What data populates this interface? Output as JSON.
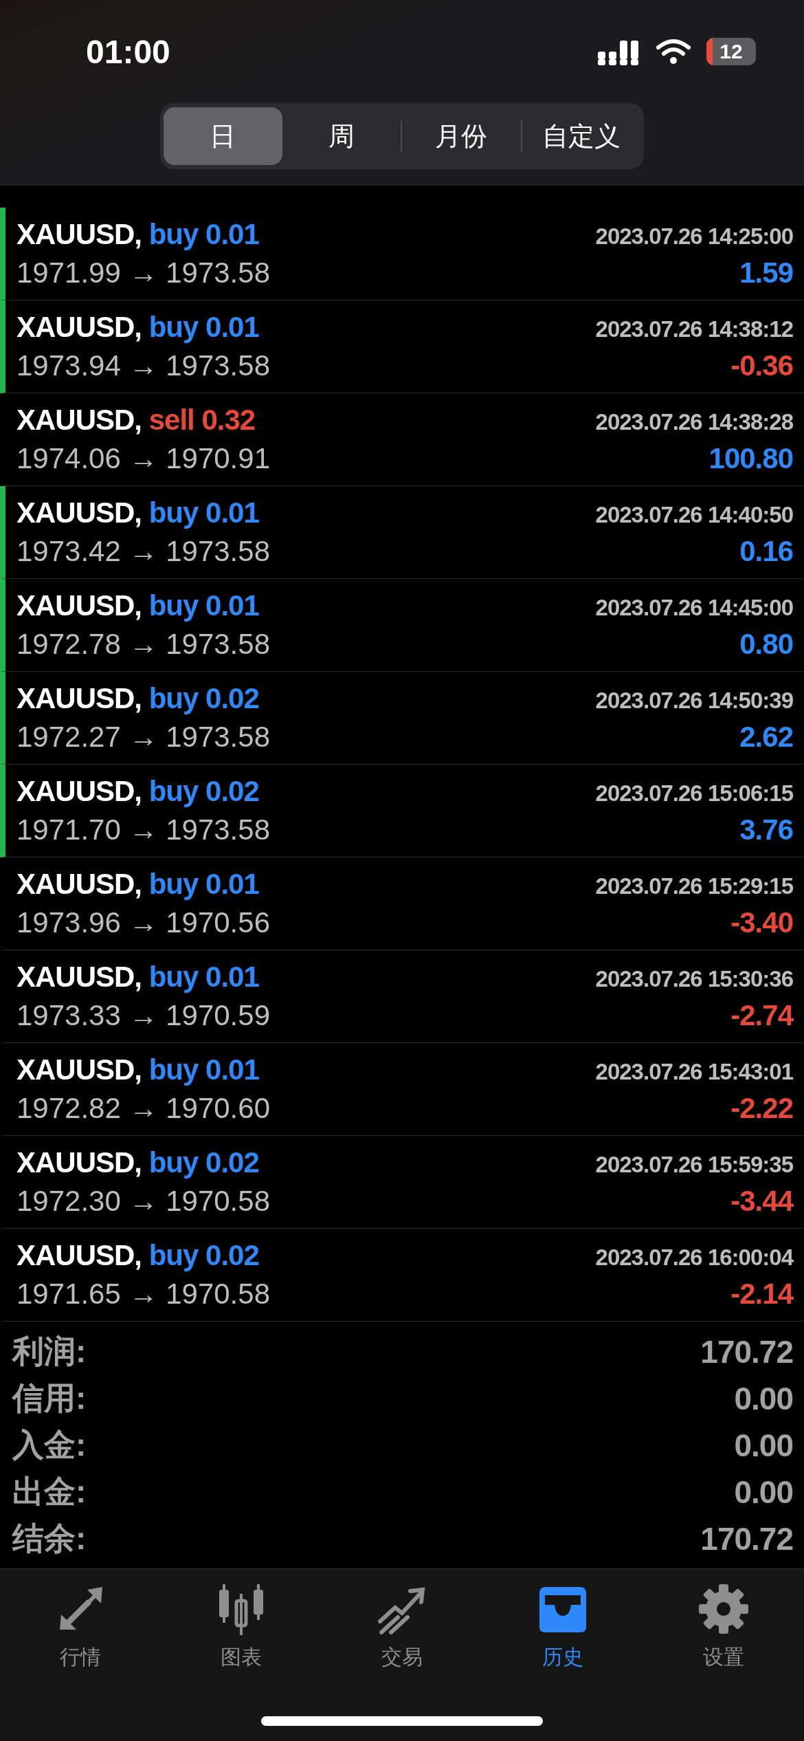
{
  "status_bar": {
    "time": "01:00",
    "battery": "12"
  },
  "period_tabs": [
    {
      "label": "日",
      "selected": true
    },
    {
      "label": "周",
      "selected": false
    },
    {
      "label": "月份",
      "selected": false
    },
    {
      "label": "自定义",
      "selected": false
    }
  ],
  "deals": [
    {
      "symbol": "XAUUSD,",
      "side": "buy",
      "kind": "buy",
      "volume": "0.01",
      "time": "2023.07.26 14:25:00",
      "open": "1971.99",
      "close": "1973.58",
      "arrow": "→",
      "profit": "1.59",
      "loss": false,
      "marked": true
    },
    {
      "symbol": "XAUUSD,",
      "side": "buy",
      "kind": "buy",
      "volume": "0.01",
      "time": "2023.07.26 14:38:12",
      "open": "1973.94",
      "close": "1973.58",
      "arrow": "→",
      "profit": "-0.36",
      "loss": true,
      "marked": true
    },
    {
      "symbol": "XAUUSD,",
      "side": "sell",
      "kind": "sell",
      "volume": "0.32",
      "time": "2023.07.26 14:38:28",
      "open": "1974.06",
      "close": "1970.91",
      "arrow": "→",
      "profit": "100.80",
      "loss": false,
      "marked": false
    },
    {
      "symbol": "XAUUSD,",
      "side": "buy",
      "kind": "buy",
      "volume": "0.01",
      "time": "2023.07.26 14:40:50",
      "open": "1973.42",
      "close": "1973.58",
      "arrow": "→",
      "profit": "0.16",
      "loss": false,
      "marked": true
    },
    {
      "symbol": "XAUUSD,",
      "side": "buy",
      "kind": "buy",
      "volume": "0.01",
      "time": "2023.07.26 14:45:00",
      "open": "1972.78",
      "close": "1973.58",
      "arrow": "→",
      "profit": "0.80",
      "loss": false,
      "marked": true
    },
    {
      "symbol": "XAUUSD,",
      "side": "buy",
      "kind": "buy",
      "volume": "0.02",
      "time": "2023.07.26 14:50:39",
      "open": "1972.27",
      "close": "1973.58",
      "arrow": "→",
      "profit": "2.62",
      "loss": false,
      "marked": true
    },
    {
      "symbol": "XAUUSD,",
      "side": "buy",
      "kind": "buy",
      "volume": "0.02",
      "time": "2023.07.26 15:06:15",
      "open": "1971.70",
      "close": "1973.58",
      "arrow": "→",
      "profit": "3.76",
      "loss": false,
      "marked": true
    },
    {
      "symbol": "XAUUSD,",
      "side": "buy",
      "kind": "buy",
      "volume": "0.01",
      "time": "2023.07.26 15:29:15",
      "open": "1973.96",
      "close": "1970.56",
      "arrow": "→",
      "profit": "-3.40",
      "loss": true,
      "marked": false
    },
    {
      "symbol": "XAUUSD,",
      "side": "buy",
      "kind": "buy",
      "volume": "0.01",
      "time": "2023.07.26 15:30:36",
      "open": "1973.33",
      "close": "1970.59",
      "arrow": "→",
      "profit": "-2.74",
      "loss": true,
      "marked": false
    },
    {
      "symbol": "XAUUSD,",
      "side": "buy",
      "kind": "buy",
      "volume": "0.01",
      "time": "2023.07.26 15:43:01",
      "open": "1972.82",
      "close": "1970.60",
      "arrow": "→",
      "profit": "-2.22",
      "loss": true,
      "marked": false
    },
    {
      "symbol": "XAUUSD,",
      "side": "buy",
      "kind": "buy",
      "volume": "0.02",
      "time": "2023.07.26 15:59:35",
      "open": "1972.30",
      "close": "1970.58",
      "arrow": "→",
      "profit": "-3.44",
      "loss": true,
      "marked": false
    },
    {
      "symbol": "XAUUSD,",
      "side": "buy",
      "kind": "buy",
      "volume": "0.02",
      "time": "2023.07.26 16:00:04",
      "open": "1971.65",
      "close": "1970.58",
      "arrow": "→",
      "profit": "-2.14",
      "loss": true,
      "marked": false
    }
  ],
  "summary": [
    {
      "label": "利润:",
      "value": "170.72"
    },
    {
      "label": "信用:",
      "value": "0.00"
    },
    {
      "label": "入金:",
      "value": "0.00"
    },
    {
      "label": "出金:",
      "value": "0.00"
    },
    {
      "label": "结余:",
      "value": "170.72"
    }
  ],
  "tab_bar": [
    {
      "label": "行情",
      "kind": "quotes",
      "selected": false
    },
    {
      "label": "图表",
      "kind": "chart",
      "selected": false
    },
    {
      "label": "交易",
      "kind": "trade",
      "selected": false
    },
    {
      "label": "历史",
      "kind": "history",
      "selected": true
    },
    {
      "label": "设置",
      "kind": "settings",
      "selected": false
    }
  ]
}
